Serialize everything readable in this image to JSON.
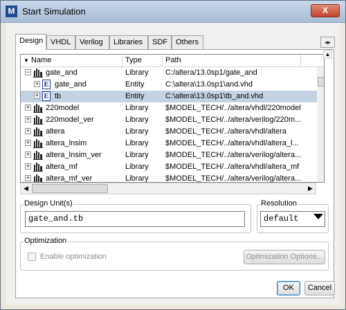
{
  "window": {
    "title": "Start Simulation",
    "app_icon_letter": "M",
    "close_glyph": "X"
  },
  "tabs": [
    {
      "label": "Design",
      "active": true
    },
    {
      "label": "VHDL"
    },
    {
      "label": "Verilog"
    },
    {
      "label": "Libraries"
    },
    {
      "label": "SDF"
    },
    {
      "label": "Others"
    }
  ],
  "tab_scroll": {
    "left": "◂",
    "right": "▸"
  },
  "list": {
    "columns": [
      "Name",
      "Type",
      "Path"
    ],
    "sort_glyph": "▼",
    "rows": [
      {
        "name": "gate_and",
        "type": "Library",
        "path": "C:/altera/13.0sp1/gate_and",
        "expander": "−",
        "icon": "library-icon",
        "level": 0
      },
      {
        "name": "gate_and",
        "type": "Entity",
        "path": "C:\\altera\\13.0sp1\\and.vhd",
        "expander": "+",
        "icon": "entity-icon",
        "level": 1,
        "icon_letter": "E"
      },
      {
        "name": "tb",
        "type": "Entity",
        "path": "C:\\altera\\13.0sp1\\tb_and.vhd",
        "expander": "+",
        "icon": "entity-icon",
        "level": 1,
        "icon_letter": "E",
        "selected": true
      },
      {
        "name": "220model",
        "type": "Library",
        "path": "$MODEL_TECH/../altera/vhdl/220model",
        "expander": "+",
        "icon": "library-icon",
        "level": 0
      },
      {
        "name": "220model_ver",
        "type": "Library",
        "path": "$MODEL_TECH/../altera/verilog/220m...",
        "expander": "+",
        "icon": "library-icon",
        "level": 0
      },
      {
        "name": "altera",
        "type": "Library",
        "path": "$MODEL_TECH/../altera/vhdl/altera",
        "expander": "+",
        "icon": "library-icon",
        "level": 0
      },
      {
        "name": "altera_lnsim",
        "type": "Library",
        "path": "$MODEL_TECH/../altera/vhdl/altera_l...",
        "expander": "+",
        "icon": "library-icon",
        "level": 0
      },
      {
        "name": "altera_lnsim_ver",
        "type": "Library",
        "path": "$MODEL_TECH/../altera/verilog/altera...",
        "expander": "+",
        "icon": "library-icon",
        "level": 0
      },
      {
        "name": "altera_mf",
        "type": "Library",
        "path": "$MODEL_TECH/../altera/vhdl/altera_mf",
        "expander": "+",
        "icon": "library-icon",
        "level": 0
      },
      {
        "name": "altera_mf_ver",
        "type": "Library",
        "path": "$MODEL_TECH/../altera/verilog/altera...",
        "expander": "+",
        "icon": "library-icon",
        "level": 0
      }
    ]
  },
  "scroll": {
    "left": "◀",
    "right": "▶",
    "up": "▲",
    "down": "▼"
  },
  "design_unit": {
    "label": "Design Unit(s)",
    "value": "gate_and.tb"
  },
  "resolution": {
    "label": "Resolution",
    "value": "default"
  },
  "optimization": {
    "label": "Optimization",
    "enable_label": "Enable optimization",
    "options_button": "Optimization Options..."
  },
  "buttons": {
    "ok": "OK",
    "cancel": "Cancel"
  }
}
